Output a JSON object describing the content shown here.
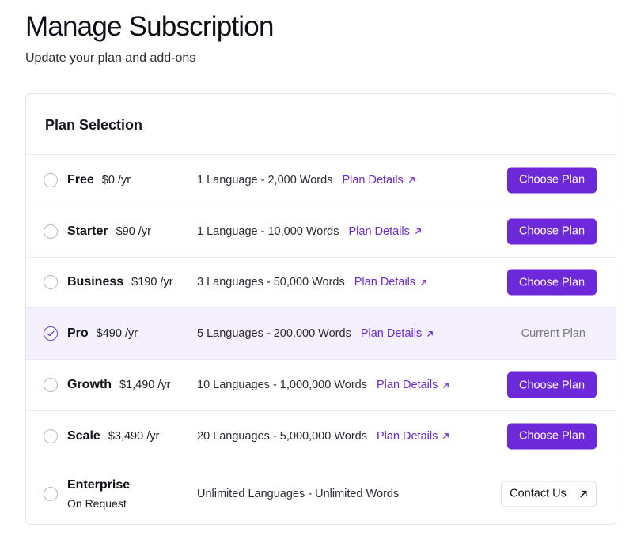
{
  "header": {
    "title": "Manage Subscription",
    "subtitle": "Update your plan and add-ons"
  },
  "plan_selection": {
    "title": "Plan Selection",
    "details_label": "Plan Details",
    "choose_label": "Choose Plan",
    "current_label": "Current Plan",
    "contact_label": "Contact Us",
    "plans": [
      {
        "name": "Free",
        "price": "$0 /yr",
        "description": "1 Language - 2,000 Words",
        "selected": false
      },
      {
        "name": "Starter",
        "price": "$90 /yr",
        "description": "1 Language - 10,000 Words",
        "selected": false
      },
      {
        "name": "Business",
        "price": "$190 /yr",
        "description": "3 Languages - 50,000 Words",
        "selected": false
      },
      {
        "name": "Pro",
        "price": "$490 /yr",
        "description": "5 Languages - 200,000 Words",
        "selected": true
      },
      {
        "name": "Growth",
        "price": "$1,490 /yr",
        "description": "10 Languages - 1,000,000 Words",
        "selected": false
      },
      {
        "name": "Scale",
        "price": "$3,490 /yr",
        "description": "20 Languages - 5,000,000 Words",
        "selected": false
      },
      {
        "name": "Enterprise",
        "price": "On Request",
        "description": "Unlimited Languages - Unlimited Words",
        "selected": false
      }
    ]
  },
  "colors": {
    "accent": "#6d28d9",
    "current_row_bg": "#f4f0fd",
    "border": "#e8e8ee"
  },
  "icons": {
    "external_link": "arrow-up-right-icon",
    "radio_checked": "check-icon"
  }
}
